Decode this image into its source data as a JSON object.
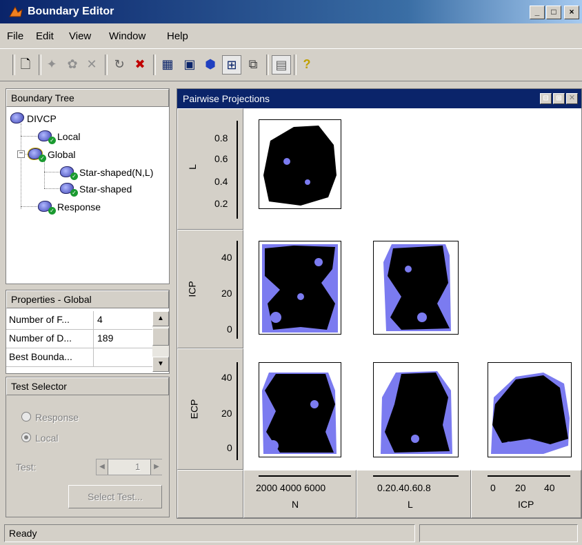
{
  "window": {
    "title": "Boundary Editor",
    "min": "_",
    "max": "□",
    "close": "×"
  },
  "menu": [
    "File",
    "Edit",
    "View",
    "Window",
    "Help"
  ],
  "tree": {
    "header": "Boundary Tree",
    "items": [
      {
        "label": "DIVCP"
      },
      {
        "label": "Local"
      },
      {
        "label": "Global"
      },
      {
        "label": "Star-shaped(N,L)"
      },
      {
        "label": "Star-shaped"
      },
      {
        "label": "Response"
      }
    ]
  },
  "properties": {
    "header": "Properties - Global",
    "rows": [
      {
        "name": "Number of F...",
        "value": "4"
      },
      {
        "name": "Number of D...",
        "value": "189"
      },
      {
        "name": "Best Bounda...",
        "value": ""
      }
    ]
  },
  "test_selector": {
    "header": "Test Selector",
    "response_label": "Response",
    "local_label": "Local",
    "selected": "Local",
    "test_label": "Test:",
    "test_value": "1",
    "select_button": "Select Test..."
  },
  "projections": {
    "title": "Pairwise Projections",
    "row_labels": [
      "L",
      "ICP",
      "ECP"
    ],
    "col_labels": [
      "N",
      "L",
      "ICP"
    ],
    "L_ticks": [
      "0.8",
      "0.6",
      "0.4",
      "0.2"
    ],
    "ICP_ticks": [
      "40",
      "20",
      "0"
    ],
    "ECP_ticks": [
      "40",
      "20",
      "0"
    ],
    "N_ticks": "2000 4000 6000",
    "Lx_ticks": "0.20.40.60.8",
    "ICPx_ticks": [
      "0",
      "20",
      "40"
    ],
    "colors": {
      "fill": "#7b7bf0",
      "points": "#000000"
    }
  },
  "status": {
    "text": "Ready"
  }
}
